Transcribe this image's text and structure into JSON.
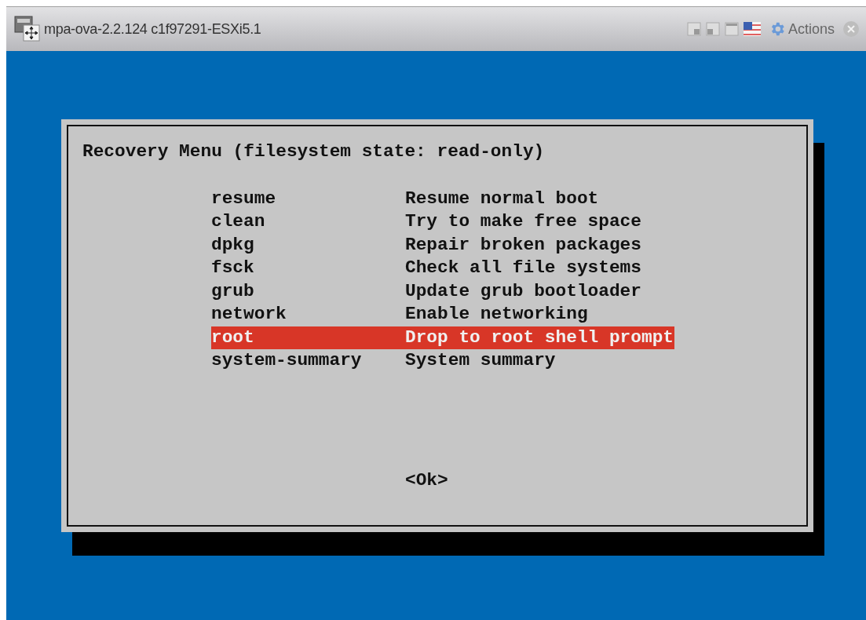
{
  "window": {
    "title": "mpa-ova-2.2.124 c1f97291-ESXi5.1",
    "actions_label": "Actions"
  },
  "dialog": {
    "title": "Recovery Menu (filesystem state: read-only)",
    "items": [
      {
        "key": "resume",
        "description": "Resume normal boot",
        "selected": false
      },
      {
        "key": "clean",
        "description": "Try to make free space",
        "selected": false
      },
      {
        "key": "dpkg",
        "description": "Repair broken packages",
        "selected": false
      },
      {
        "key": "fsck",
        "description": "Check all file systems",
        "selected": false
      },
      {
        "key": "grub",
        "description": "Update grub bootloader",
        "selected": false
      },
      {
        "key": "network",
        "description": "Enable networking",
        "selected": false
      },
      {
        "key": "root",
        "description": "Drop to root shell prompt",
        "selected": true
      },
      {
        "key": "system-summary",
        "description": "System summary",
        "selected": false
      }
    ],
    "button": "<Ok>"
  }
}
